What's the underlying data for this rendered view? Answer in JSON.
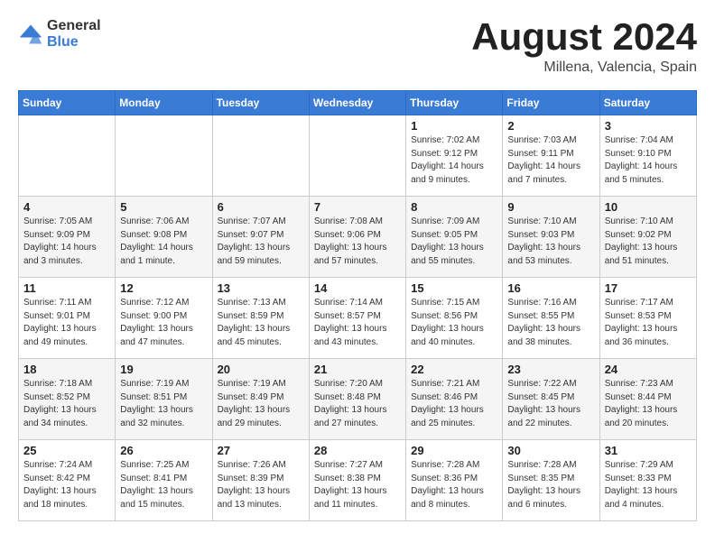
{
  "logo": {
    "general": "General",
    "blue": "Blue"
  },
  "title": {
    "month_year": "August 2024",
    "location": "Millena, Valencia, Spain"
  },
  "weekdays": [
    "Sunday",
    "Monday",
    "Tuesday",
    "Wednesday",
    "Thursday",
    "Friday",
    "Saturday"
  ],
  "weeks": [
    [
      {
        "day": "",
        "info": ""
      },
      {
        "day": "",
        "info": ""
      },
      {
        "day": "",
        "info": ""
      },
      {
        "day": "",
        "info": ""
      },
      {
        "day": "1",
        "info": "Sunrise: 7:02 AM\nSunset: 9:12 PM\nDaylight: 14 hours\nand 9 minutes."
      },
      {
        "day": "2",
        "info": "Sunrise: 7:03 AM\nSunset: 9:11 PM\nDaylight: 14 hours\nand 7 minutes."
      },
      {
        "day": "3",
        "info": "Sunrise: 7:04 AM\nSunset: 9:10 PM\nDaylight: 14 hours\nand 5 minutes."
      }
    ],
    [
      {
        "day": "4",
        "info": "Sunrise: 7:05 AM\nSunset: 9:09 PM\nDaylight: 14 hours\nand 3 minutes."
      },
      {
        "day": "5",
        "info": "Sunrise: 7:06 AM\nSunset: 9:08 PM\nDaylight: 14 hours\nand 1 minute."
      },
      {
        "day": "6",
        "info": "Sunrise: 7:07 AM\nSunset: 9:07 PM\nDaylight: 13 hours\nand 59 minutes."
      },
      {
        "day": "7",
        "info": "Sunrise: 7:08 AM\nSunset: 9:06 PM\nDaylight: 13 hours\nand 57 minutes."
      },
      {
        "day": "8",
        "info": "Sunrise: 7:09 AM\nSunset: 9:05 PM\nDaylight: 13 hours\nand 55 minutes."
      },
      {
        "day": "9",
        "info": "Sunrise: 7:10 AM\nSunset: 9:03 PM\nDaylight: 13 hours\nand 53 minutes."
      },
      {
        "day": "10",
        "info": "Sunrise: 7:10 AM\nSunset: 9:02 PM\nDaylight: 13 hours\nand 51 minutes."
      }
    ],
    [
      {
        "day": "11",
        "info": "Sunrise: 7:11 AM\nSunset: 9:01 PM\nDaylight: 13 hours\nand 49 minutes."
      },
      {
        "day": "12",
        "info": "Sunrise: 7:12 AM\nSunset: 9:00 PM\nDaylight: 13 hours\nand 47 minutes."
      },
      {
        "day": "13",
        "info": "Sunrise: 7:13 AM\nSunset: 8:59 PM\nDaylight: 13 hours\nand 45 minutes."
      },
      {
        "day": "14",
        "info": "Sunrise: 7:14 AM\nSunset: 8:57 PM\nDaylight: 13 hours\nand 43 minutes."
      },
      {
        "day": "15",
        "info": "Sunrise: 7:15 AM\nSunset: 8:56 PM\nDaylight: 13 hours\nand 40 minutes."
      },
      {
        "day": "16",
        "info": "Sunrise: 7:16 AM\nSunset: 8:55 PM\nDaylight: 13 hours\nand 38 minutes."
      },
      {
        "day": "17",
        "info": "Sunrise: 7:17 AM\nSunset: 8:53 PM\nDaylight: 13 hours\nand 36 minutes."
      }
    ],
    [
      {
        "day": "18",
        "info": "Sunrise: 7:18 AM\nSunset: 8:52 PM\nDaylight: 13 hours\nand 34 minutes."
      },
      {
        "day": "19",
        "info": "Sunrise: 7:19 AM\nSunset: 8:51 PM\nDaylight: 13 hours\nand 32 minutes."
      },
      {
        "day": "20",
        "info": "Sunrise: 7:19 AM\nSunset: 8:49 PM\nDaylight: 13 hours\nand 29 minutes."
      },
      {
        "day": "21",
        "info": "Sunrise: 7:20 AM\nSunset: 8:48 PM\nDaylight: 13 hours\nand 27 minutes."
      },
      {
        "day": "22",
        "info": "Sunrise: 7:21 AM\nSunset: 8:46 PM\nDaylight: 13 hours\nand 25 minutes."
      },
      {
        "day": "23",
        "info": "Sunrise: 7:22 AM\nSunset: 8:45 PM\nDaylight: 13 hours\nand 22 minutes."
      },
      {
        "day": "24",
        "info": "Sunrise: 7:23 AM\nSunset: 8:44 PM\nDaylight: 13 hours\nand 20 minutes."
      }
    ],
    [
      {
        "day": "25",
        "info": "Sunrise: 7:24 AM\nSunset: 8:42 PM\nDaylight: 13 hours\nand 18 minutes."
      },
      {
        "day": "26",
        "info": "Sunrise: 7:25 AM\nSunset: 8:41 PM\nDaylight: 13 hours\nand 15 minutes."
      },
      {
        "day": "27",
        "info": "Sunrise: 7:26 AM\nSunset: 8:39 PM\nDaylight: 13 hours\nand 13 minutes."
      },
      {
        "day": "28",
        "info": "Sunrise: 7:27 AM\nSunset: 8:38 PM\nDaylight: 13 hours\nand 11 minutes."
      },
      {
        "day": "29",
        "info": "Sunrise: 7:28 AM\nSunset: 8:36 PM\nDaylight: 13 hours\nand 8 minutes."
      },
      {
        "day": "30",
        "info": "Sunrise: 7:28 AM\nSunset: 8:35 PM\nDaylight: 13 hours\nand 6 minutes."
      },
      {
        "day": "31",
        "info": "Sunrise: 7:29 AM\nSunset: 8:33 PM\nDaylight: 13 hours\nand 4 minutes."
      }
    ]
  ]
}
